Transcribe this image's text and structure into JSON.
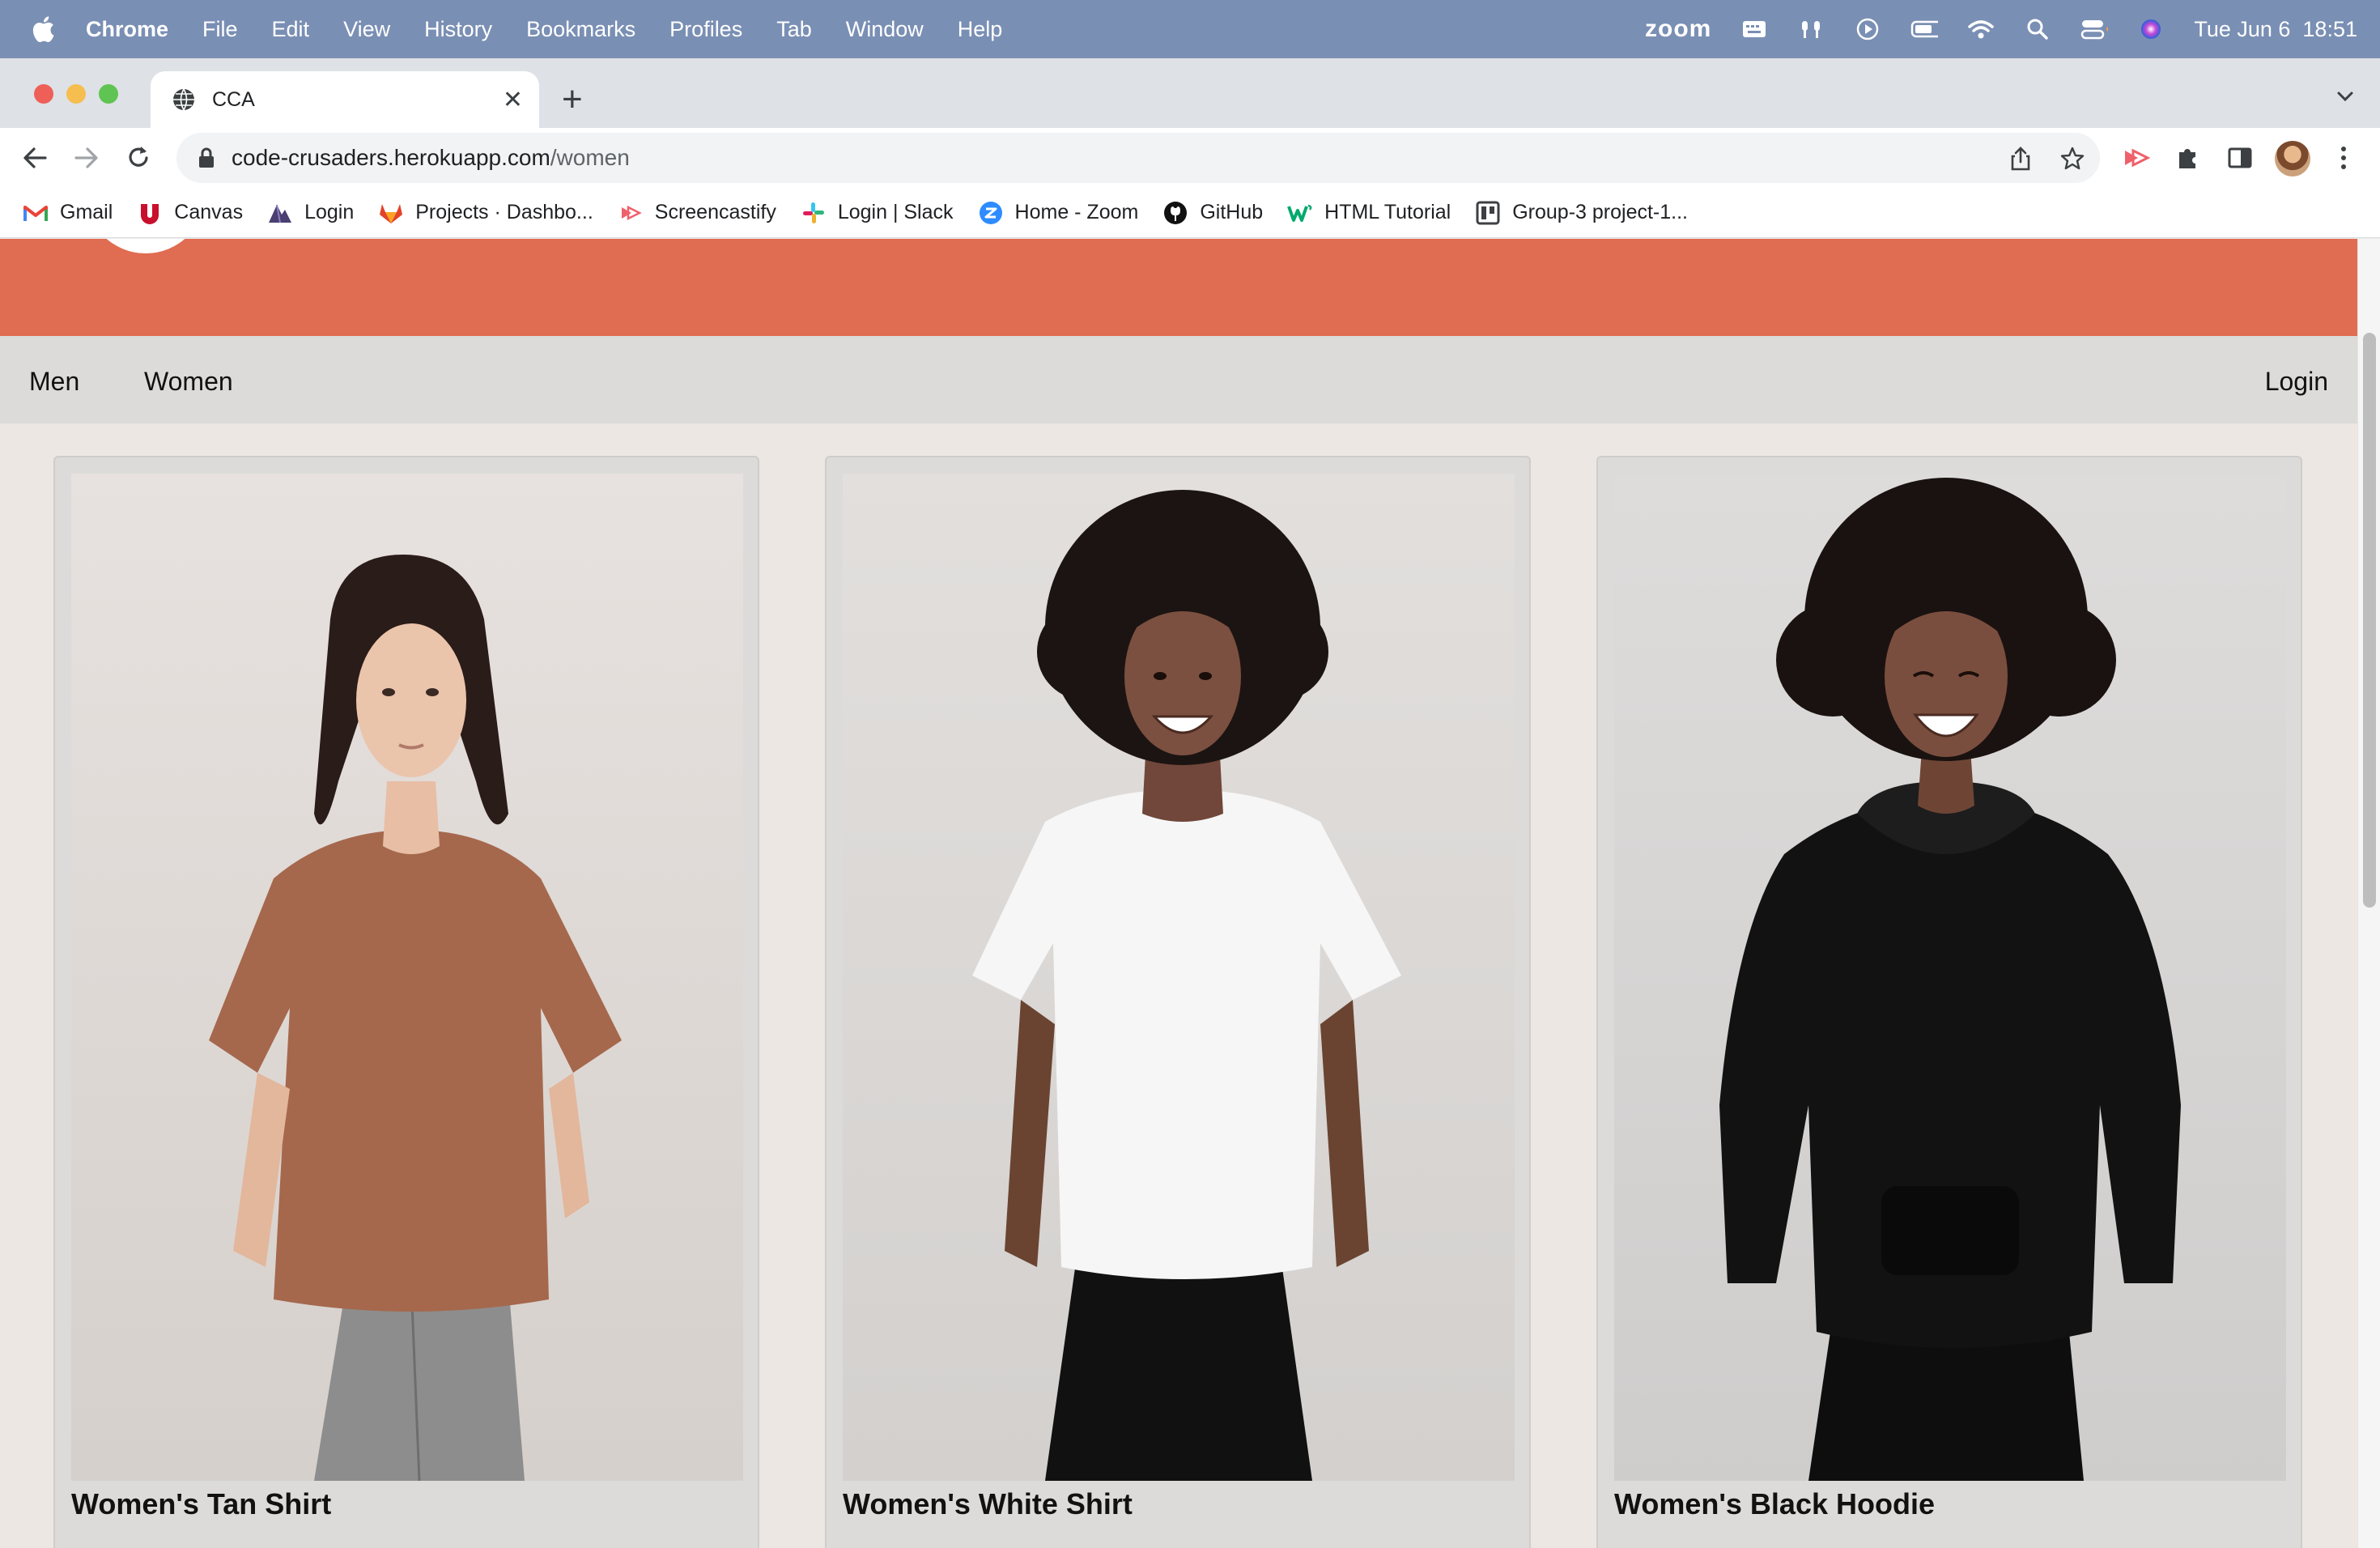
{
  "menubar": {
    "app": "Chrome",
    "items": [
      "File",
      "Edit",
      "View",
      "History",
      "Bookmarks",
      "Profiles",
      "Tab",
      "Window",
      "Help"
    ],
    "zoom": "zoom",
    "datetime": "Tue Jun 6  18:51"
  },
  "tab": {
    "title": "CCA"
  },
  "address": {
    "host": "code-crusaders.herokuapp.com",
    "path": "/women"
  },
  "bookmarks": [
    {
      "label": "Gmail",
      "icon": "gmail-icon"
    },
    {
      "label": "Canvas",
      "icon": "canvas-icon"
    },
    {
      "label": "Login",
      "icon": "login-icon"
    },
    {
      "label": "Projects · Dashbo...",
      "icon": "gitlab-icon"
    },
    {
      "label": "Screencastify",
      "icon": "screencastify-icon"
    },
    {
      "label": "Login | Slack",
      "icon": "slack-icon"
    },
    {
      "label": "Home - Zoom",
      "icon": "zoom-icon"
    },
    {
      "label": "GitHub",
      "icon": "github-icon"
    },
    {
      "label": "HTML Tutorial",
      "icon": "w3schools-icon"
    },
    {
      "label": "Group-3 project-1...",
      "icon": "trello-icon"
    }
  ],
  "site": {
    "nav": {
      "men": "Men",
      "women": "Women",
      "login": "Login"
    },
    "products": [
      {
        "name": "Women's Tan Shirt"
      },
      {
        "name": "Women's White Shirt"
      },
      {
        "name": "Women's Black Hoodie"
      }
    ]
  },
  "colors": {
    "hero": "#e06c51",
    "nav": "#dcdbd9",
    "page": "#ece7e2"
  }
}
